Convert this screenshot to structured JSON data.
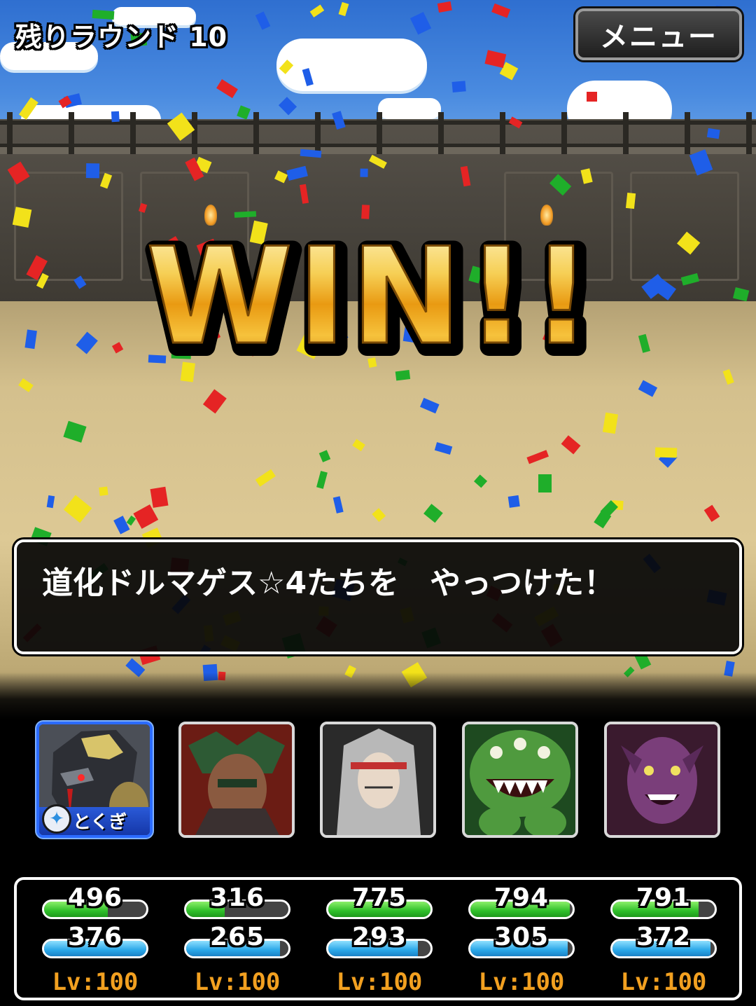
{
  "hud": {
    "rounds_left": "残りラウンド 10",
    "menu_label": "メニュー"
  },
  "banner": {
    "text": "WIN!!"
  },
  "message": {
    "text": "道化ドルマゲス☆4たちを　やっつけた！"
  },
  "party": [
    {
      "hp": "496",
      "mp": "376",
      "hp_fraction": 0.62,
      "mp_fraction": 1.0,
      "level": "Lv:100",
      "selected": true,
      "badge": "とくぎ"
    },
    {
      "hp": "316",
      "mp": "265",
      "hp_fraction": 0.38,
      "mp_fraction": 0.92,
      "level": "Lv:100"
    },
    {
      "hp": "775",
      "mp": "293",
      "hp_fraction": 1.0,
      "mp_fraction": 0.88,
      "level": "Lv:100"
    },
    {
      "hp": "794",
      "mp": "305",
      "hp_fraction": 0.97,
      "mp_fraction": 0.95,
      "level": "Lv:100"
    },
    {
      "hp": "791",
      "mp": "372",
      "hp_fraction": 0.84,
      "mp_fraction": 0.96,
      "level": "Lv:100"
    }
  ],
  "colors": {
    "hp_bar": "#2fbf2a",
    "mp_bar": "#2aa7e8",
    "level_text": "#f2a020",
    "win_gold": "#f2b32a",
    "selected_border": "#2b6bff"
  },
  "icons": {
    "badge_icon": "crystal-shield-icon"
  }
}
